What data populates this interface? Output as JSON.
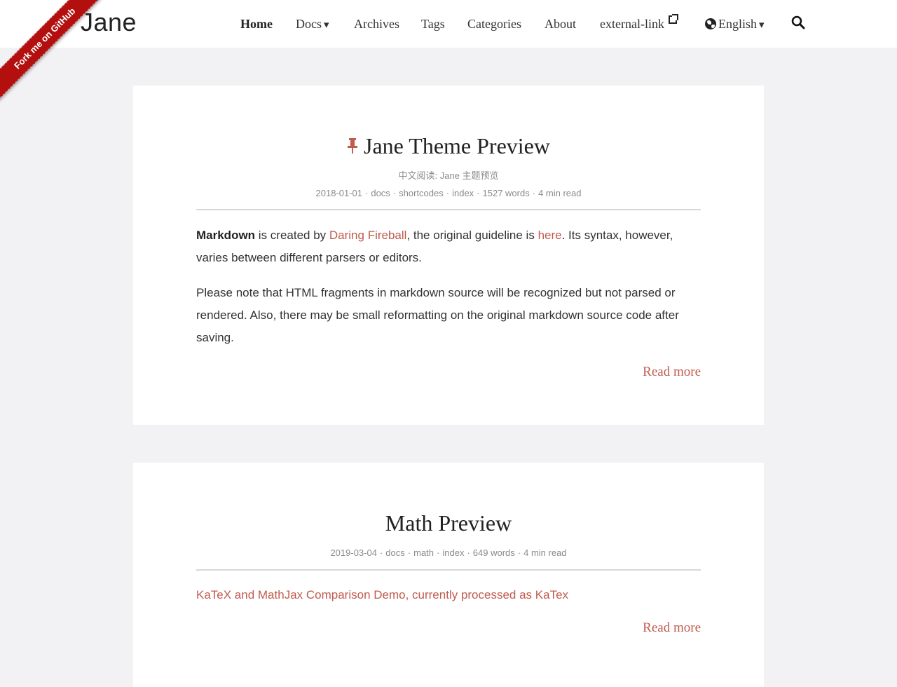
{
  "site": {
    "logo": "Jane",
    "ribbon_label": "Fork me on GitHub"
  },
  "nav": {
    "items": [
      {
        "label": "Home",
        "active": true
      },
      {
        "label": "Docs",
        "caret": "▾"
      },
      {
        "label": "Archives"
      },
      {
        "label": "Tags"
      },
      {
        "label": "Categories"
      },
      {
        "label": "About"
      },
      {
        "label": "external-link",
        "icon": "external-link-icon"
      },
      {
        "label": "English",
        "caret": "▾",
        "icon": "globe-icon"
      }
    ],
    "search_icon": "search-icon"
  },
  "posts": [
    {
      "pinned": true,
      "title": "Jane Theme Preview",
      "subtitle": "中文阅读: Jane 主题预览",
      "meta": {
        "date": "2018-01-01",
        "category": "docs",
        "tag1": "shortcodes",
        "tag2": "index",
        "words": "1527 words",
        "read_time": "4 min read"
      },
      "body": {
        "p1_bold": "Markdown",
        "p1_a": " is created by ",
        "p1_link1": "Daring Fireball",
        "p1_b": ", the original guideline is ",
        "p1_link2": "here",
        "p1_c": ". Its syntax, however, varies between different parsers or editors.",
        "p2": "Please note that HTML fragments in markdown source will be recognized but not parsed or rendered. Also, there may be small reformatting on the original markdown source code after saving."
      },
      "read_more": "Read more"
    },
    {
      "title": "Math Preview",
      "meta": {
        "date": "2019-03-04",
        "category": "docs",
        "tag1": "math",
        "tag2": "index",
        "words": "649 words",
        "read_time": "4 min read"
      },
      "body": {
        "link": "KaTeX and MathJax Comparison Demo, currently processed as KaTex"
      },
      "read_more": "Read more"
    }
  ],
  "colors": {
    "accent": "#c05b4d",
    "ribbon": "#b40f0f",
    "background": "#f2f2f4",
    "card": "#ffffff"
  }
}
